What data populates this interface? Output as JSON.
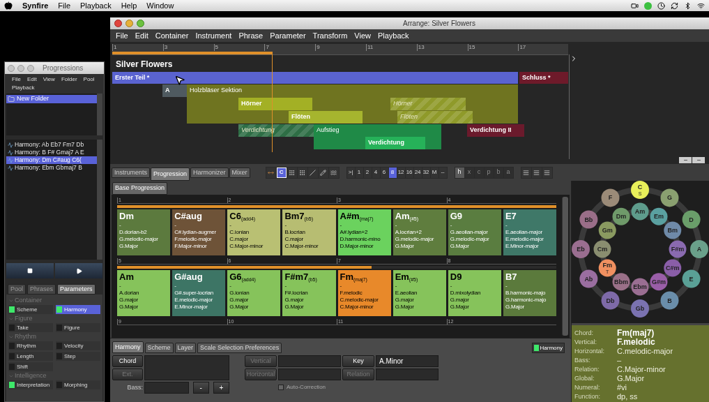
{
  "menubar": {
    "items": [
      "Synfire",
      "File",
      "Playback",
      "Help",
      "Window"
    ]
  },
  "progressions": {
    "title": "Progressions",
    "menu": [
      "File",
      "Edit",
      "View",
      "Folder",
      "Pool",
      "Playback"
    ],
    "folders": [
      {
        "label": "New Folder",
        "selected": true
      }
    ],
    "items": [
      {
        "label": "Harmony: Ab Eb7 Fm7 Db",
        "selected": false
      },
      {
        "label": "Harmony: B F# Gmaj7 A E",
        "selected": false
      },
      {
        "label": "Harmony: Dm C#aug C6(",
        "selected": true
      },
      {
        "label": "Harmony: Ebm Gbmaj7 B",
        "selected": false
      }
    ],
    "tabs": [
      {
        "label": "Pool",
        "selected": false
      },
      {
        "label": "Phrases",
        "selected": false
      },
      {
        "label": "Parameters",
        "selected": true
      }
    ],
    "groups": [
      {
        "title": "Container",
        "items": [
          {
            "label": "Scheme",
            "on": true,
            "selected": false
          },
          {
            "label": "Harmony",
            "on": true,
            "selected": true
          }
        ]
      },
      {
        "title": "Figure",
        "items": [
          {
            "label": "Take",
            "on": false,
            "selected": false
          },
          {
            "label": "Figure",
            "on": false,
            "selected": false
          }
        ]
      },
      {
        "title": "Rhythm",
        "items": [
          {
            "label": "Rhythm",
            "on": false,
            "selected": false
          },
          {
            "label": "Velocity",
            "on": false,
            "selected": false
          },
          {
            "label": "Length",
            "on": false,
            "selected": false
          },
          {
            "label": "Step",
            "on": false,
            "selected": false
          },
          {
            "label": "Shift",
            "on": false,
            "selected": false
          }
        ]
      },
      {
        "title": "Intelligence",
        "items": [
          {
            "label": "Interpretation",
            "on": true,
            "selected": false
          },
          {
            "label": "Morphing",
            "on": false,
            "selected": false
          }
        ]
      }
    ]
  },
  "arrange": {
    "title": "Arrange: Silver Flowers",
    "menu": [
      "File",
      "Edit",
      "Container",
      "Instrument",
      "Phrase",
      "Parameter",
      "Transform",
      "View",
      "Playback"
    ],
    "ruler": [
      "1",
      "3",
      "5",
      "7",
      "9",
      "11",
      "13",
      "15",
      "17"
    ],
    "song_title": "Silver Flowers",
    "blocks": [
      {
        "label": "Erster Teil *",
        "kind": "section",
        "color": "#5a63d0"
      },
      {
        "label": "Schluss *",
        "kind": "section",
        "color": "#6e1a2a"
      },
      {
        "label": "A",
        "kind": "section",
        "color": "#4f5a60"
      },
      {
        "label": "Holzbläser Sektion",
        "kind": "container",
        "color": "#6f7420"
      },
      {
        "label": "Hörner",
        "kind": "phrase",
        "color": "#a3b025"
      },
      {
        "label": "Hörner",
        "kind": "ghost",
        "color": "#8f9a2a"
      },
      {
        "label": "Flöten",
        "kind": "phrase",
        "color": "#a6b52e"
      },
      {
        "label": "Flöten",
        "kind": "ghost",
        "color": "#8f9a2a"
      },
      {
        "label": "Verdichtung",
        "kind": "ghost",
        "color": "#2e6e45"
      },
      {
        "label": "Aufstieg",
        "kind": "container",
        "color": "#1f8a47"
      },
      {
        "label": "Verdichtung",
        "kind": "phrase",
        "color": "#26b259"
      },
      {
        "label": "Verdichtung II",
        "kind": "section",
        "color": "#6b1a2c"
      }
    ]
  },
  "toolbar": {
    "tabs": [
      {
        "label": "Instruments",
        "selected": false
      },
      {
        "label": "Progression",
        "selected": true
      },
      {
        "label": "Harmonizer",
        "selected": false
      },
      {
        "label": "Mixer",
        "selected": false
      }
    ],
    "tools": [
      {
        "selected": false
      },
      {
        "label": "C",
        "selected": true
      },
      {
        "selected": false
      },
      {
        "selected": false
      },
      {
        "selected": false
      },
      {
        "selected": false
      },
      {
        "selected": false
      }
    ],
    "grid": [
      {
        "label": ">|",
        "selected": false
      },
      {
        "label": "1",
        "selected": false
      },
      {
        "label": "2",
        "selected": false
      },
      {
        "label": "4",
        "selected": false
      },
      {
        "label": "6",
        "selected": false
      },
      {
        "label": "8",
        "selected": true
      },
      {
        "label": "12",
        "selected": false
      },
      {
        "label": "16",
        "selected": false
      },
      {
        "label": "24",
        "selected": false
      },
      {
        "label": "32",
        "selected": false
      },
      {
        "label": "M",
        "selected": false
      },
      {
        "label": "--",
        "selected": false
      }
    ],
    "letters": [
      {
        "label": "h",
        "disabled": false
      },
      {
        "label": "x",
        "disabled": true
      },
      {
        "label": "c",
        "disabled": true
      },
      {
        "label": "p",
        "disabled": true
      },
      {
        "label": "b",
        "disabled": true
      },
      {
        "label": "a",
        "disabled": true
      }
    ]
  },
  "progression": {
    "tab": "Base Progression",
    "rows": [
      {
        "bars": [
          "1",
          "2",
          "3",
          "4"
        ],
        "level": 1,
        "chords": [
          {
            "name": "Dm",
            "color": "#5c7a3e",
            "lines": [
              "-",
              "D.dorian-b2",
              "G.melodic-major",
              "G.Major"
            ]
          },
          {
            "name": "C#aug",
            "color": "#6e5338",
            "lines": [
              "-",
              "C#.lydian-augmer",
              "F.melodic-major",
              "F.Major-minor"
            ]
          },
          {
            "name": "C6$_{(add4)}$",
            "color": "#b9c073",
            "lines": [
              "-",
              "C.ionian",
              "C.major",
              "C.Major-minor"
            ]
          },
          {
            "name": "Bm7$_{(b5)}$",
            "color": "#b7bd72",
            "lines": [
              "-",
              "B.locrian",
              "C.major",
              "C.Major-minor"
            ]
          },
          {
            "name": "A#m$_{(maj7)}$",
            "color": "#6bd25e",
            "lines": [
              "-",
              "A#.lydian+2",
              "D.harmonic-mino",
              "D.Major-minor"
            ]
          },
          {
            "name": "Am$_{(#5)}$",
            "color": "#5f7d3e",
            "lines": [
              "-",
              "A.locrian+2",
              "G.melodic-major",
              "G.Major"
            ]
          },
          {
            "name": "G9",
            "color": "#5a7d40",
            "lines": [
              "-",
              "G.aeolian-major",
              "G.melodic-major",
              "G.Major"
            ]
          },
          {
            "name": "E7",
            "color": "#3f7868",
            "lines": [
              "-",
              "E.aeolian-major",
              "E.melodic-major",
              "E.Minor-major"
            ]
          }
        ]
      },
      {
        "bars": [
          "5",
          "6",
          "7",
          "8"
        ],
        "level": 0.58,
        "chords": [
          {
            "name": "Am",
            "color": "#86c35b",
            "lines": [
              "-",
              "A.dorian",
              "G.major",
              "G.Major"
            ]
          },
          {
            "name": "G#aug",
            "color": "#3d7565",
            "lines": [
              "-",
              "G#.super-locrian",
              "E.melodic-major",
              "E.Minor-major"
            ]
          },
          {
            "name": "G6$_{(add4)}$",
            "color": "#86c35b",
            "lines": [
              "-",
              "G.ionian",
              "G.major",
              "G.Major"
            ]
          },
          {
            "name": "F#m7$_{(b5)}$",
            "color": "#86c35b",
            "lines": [
              "-",
              "F#.locrian",
              "G.major",
              "G.Major"
            ]
          },
          {
            "name": "Fm$_{(maj7)}$",
            "color": "#e8892a",
            "lines": [
              "-",
              "F.melodic",
              "C.melodic-major",
              "C.Major-minor"
            ]
          },
          {
            "name": "Em$_{(#5)}$",
            "color": "#86c35b",
            "lines": [
              "-",
              "E.aeolian",
              "G.major",
              "G.Major"
            ]
          },
          {
            "name": "D9",
            "color": "#86c35b",
            "lines": [
              "-",
              "D.mixolydian",
              "G.major",
              "G.Major"
            ]
          },
          {
            "name": "B7",
            "color": "#5b7a3c",
            "lines": [
              "-",
              "B.harmonic-majo",
              "G.harmonic-majo",
              "G.Major"
            ]
          }
        ]
      },
      {
        "bars": [
          "9",
          "10",
          "11",
          "12"
        ]
      }
    ]
  },
  "circle": {
    "majors": [
      {
        "label": "C",
        "color": "#e8ef5a",
        "mark": "S"
      },
      {
        "label": "G",
        "color": "#8aa070"
      },
      {
        "label": "D",
        "color": "#6a9e6a"
      },
      {
        "label": "A",
        "color": "#6aa08a"
      },
      {
        "label": "E",
        "color": "#5aa096"
      },
      {
        "label": "B",
        "color": "#6a8eaa"
      },
      {
        "label": "Gb",
        "color": "#7a72b0"
      },
      {
        "label": "Db",
        "color": "#7e6aa8"
      },
      {
        "label": "Ab",
        "color": "#9a6ea0"
      },
      {
        "label": "Eb",
        "color": "#9a6e90"
      },
      {
        "label": "Bb",
        "color": "#9a6e88"
      },
      {
        "label": "F",
        "color": "#9b8b78"
      }
    ],
    "minors": [
      {
        "label": "Am",
        "color": "#5e9c8c"
      },
      {
        "label": "Em",
        "color": "#5aa0a0"
      },
      {
        "label": "Bm",
        "color": "#6f8aa8"
      },
      {
        "label": "F#m",
        "color": "#8a6ab0"
      },
      {
        "label": "C#m",
        "color": "#8a5ea8"
      },
      {
        "label": "G#m",
        "color": "#9a5ea8"
      },
      {
        "label": "Ebm",
        "color": "#9a6e92"
      },
      {
        "label": "Bbm",
        "color": "#9a7088"
      },
      {
        "label": "Fm",
        "color": "#f09060",
        "mark": "T"
      },
      {
        "label": "Cm",
        "color": "#8a8e70"
      },
      {
        "label": "Gm",
        "color": "#8a9a60"
      },
      {
        "label": "Dm",
        "color": "#6f9a6a"
      }
    ]
  },
  "info": [
    {
      "label": "Chord:",
      "value": "Fm(maj7)",
      "kind": "primary"
    },
    {
      "label": "Vertical:",
      "value": "F.melodic",
      "kind": "primary"
    },
    {
      "label": "Horizontal:",
      "value": "C.melodic-major",
      "kind": "secondary"
    },
    {
      "label": "Bass:",
      "value": "–",
      "kind": "secondary"
    },
    {
      "label": "Relation:",
      "value": "C.Major-minor",
      "kind": "secondary"
    },
    {
      "label": "Global:",
      "value": "G.Major",
      "kind": "secondary"
    },
    {
      "label": "Numeral:",
      "value": "#vi",
      "kind": "secondary"
    },
    {
      "label": "Function:",
      "value": "dp, ss",
      "kind": "secondary"
    }
  ],
  "editor": {
    "tabs": [
      {
        "label": "Harmony",
        "selected": true
      },
      {
        "label": "Scheme",
        "selected": false
      },
      {
        "label": "Layer",
        "selected": false
      },
      {
        "label": "Scale Selection Preferences",
        "selected": false
      }
    ],
    "indicator": {
      "label": "Harmony",
      "on": true
    },
    "chord_button": {
      "label": "Chord",
      "disabled": false
    },
    "ext_button": {
      "label": "Ext.",
      "disabled": true
    },
    "bass_label": "Bass:",
    "minus": "-",
    "plus": "+",
    "vertical_button": {
      "label": "Vertical",
      "disabled": true
    },
    "horizontal_button": {
      "label": "Horizontal",
      "disabled": true
    },
    "key_button": {
      "label": "Key",
      "disabled": false
    },
    "key_value": "A.Minor",
    "relation_button": {
      "label": "Relation",
      "disabled": true
    },
    "auto_correction": {
      "label": "Auto-Correction",
      "checked": false,
      "disabled": true
    }
  }
}
